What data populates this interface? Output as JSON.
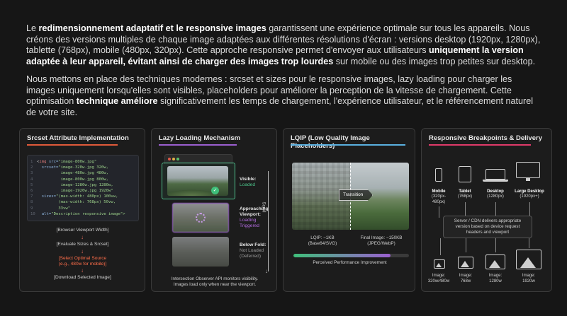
{
  "intro": {
    "p1_a": "Le ",
    "p1_b1": "redimensionnement adaptatif et le responsive images",
    "p1_c": " garantissent une expérience optimale sur tous les appareils. Nous créons des versions multiples de chaque image adaptées aux différentes résolutions d'écran : versions desktop (1920px, 1280px), tablette (768px), mobile (480px, 320px). Cette approche responsive permet d'envoyer aux utilisateurs ",
    "p1_b2": "uniquement la version adaptée à leur appareil, évitant ainsi de charger des images trop lourdes",
    "p1_d": " sur mobile ou des images trop petites sur desktop.",
    "p2_a": "Nous mettons en place des techniques modernes : srcset et sizes pour le responsive images, lazy loading pour charger les images uniquement lorsqu'elles sont visibles, placeholders pour améliorer la perception de la vitesse de chargement. Cette optimisation ",
    "p2_b": "technique améliore",
    "p2_c": " significativement les temps de chargement, l'expérience utilisateur, et le référencement naturel de votre site."
  },
  "panel1": {
    "title": "Srcset Attribute Implementation",
    "accent": "#e05a3a",
    "code_lines": [
      {
        "n": "1",
        "pre": "<",
        "tag": "img",
        "attr": " src=",
        "str": "\"image-800w.jpg\""
      },
      {
        "n": "2",
        "pre": "  ",
        "tag": "",
        "attr": "srcset=",
        "str": "\"image-320w.jpg 320w,"
      },
      {
        "n": "3",
        "pre": "          ",
        "tag": "",
        "attr": "",
        "str": "image-480w.jpg 480w,"
      },
      {
        "n": "4",
        "pre": "          ",
        "tag": "",
        "attr": "",
        "str": "image-800w.jpg 800w,"
      },
      {
        "n": "5",
        "pre": "          ",
        "tag": "",
        "attr": "",
        "str": "image-1280w.jpg 1280w,"
      },
      {
        "n": "6",
        "pre": "          ",
        "tag": "",
        "attr": "",
        "str": "image-1920w.jpg 1920w\""
      },
      {
        "n": "7",
        "pre": "  ",
        "tag": "",
        "attr": "sizes=",
        "str": "\"(max-width: 480px) 100vw,"
      },
      {
        "n": "8",
        "pre": "         ",
        "tag": "",
        "attr": "",
        "str": "(max-width: 768px) 50vw,"
      },
      {
        "n": "9",
        "pre": "         ",
        "tag": "",
        "attr": "",
        "str": "33vw\""
      },
      {
        "n": "10",
        "pre": "  ",
        "tag": "",
        "attr": "alt=",
        "str": "\"Description responsive image\">"
      }
    ],
    "step1": "[Browser Viewport Width]",
    "step2": "[Evaluate Sizes & Srcset]",
    "step3_l1": "[Select Optimal Source",
    "step3_l2": "(e.g., 480w for mobile)]",
    "step4": "[Download Selected Image]"
  },
  "panel2": {
    "title": "Lazy Loading Mechanism",
    "accent": "#9b5fd0",
    "visible_h": "Visible:",
    "visible_s": "Loaded",
    "approach_h1": "Approaching",
    "approach_h2": "Viewport:",
    "approach_s1": "Loading",
    "approach_s2": "Triggered",
    "below_h": "Below Fold:",
    "below_s1": "Not Loaded",
    "below_s2": "(Deferred)",
    "scroll": "Scroll",
    "caption1": "Intersection Observer API monitors visibility.",
    "caption2": "Images load only when near the viewport."
  },
  "panel3": {
    "title": "LQIP (Low Quality Image Placeholders)",
    "accent": "#5ab0e0",
    "transition": "Transition",
    "lqip_l1": "LQIP: ~1KB",
    "lqip_l2": "(Base64/SVG)",
    "final_l1": "Final Image: ~150KB",
    "final_l2": "(JPEG/WebP)",
    "progress": 0.84,
    "perf": "Perceived Performance Improvement"
  },
  "panel4": {
    "title": "Responsive Breakpoints & Delivery",
    "accent": "#e03a6a",
    "devices": [
      {
        "name": "Mobile",
        "range": "(320px-480px)"
      },
      {
        "name": "Tablet",
        "range": "(768px)"
      },
      {
        "name": "Desktop",
        "range": "(1280px)"
      },
      {
        "name": "Large Desktop",
        "range": "(1920px+)"
      }
    ],
    "server_l1": "Server / CDN delivers appropriate",
    "server_l2": "version based on device request",
    "server_l3": "headers and viewport",
    "images": [
      {
        "l1": "Image:",
        "l2": "320w/480w"
      },
      {
        "l1": "Image:",
        "l2": "768w"
      },
      {
        "l1": "Image:",
        "l2": "1280w"
      },
      {
        "l1": "Image:",
        "l2": "1920w"
      }
    ]
  }
}
